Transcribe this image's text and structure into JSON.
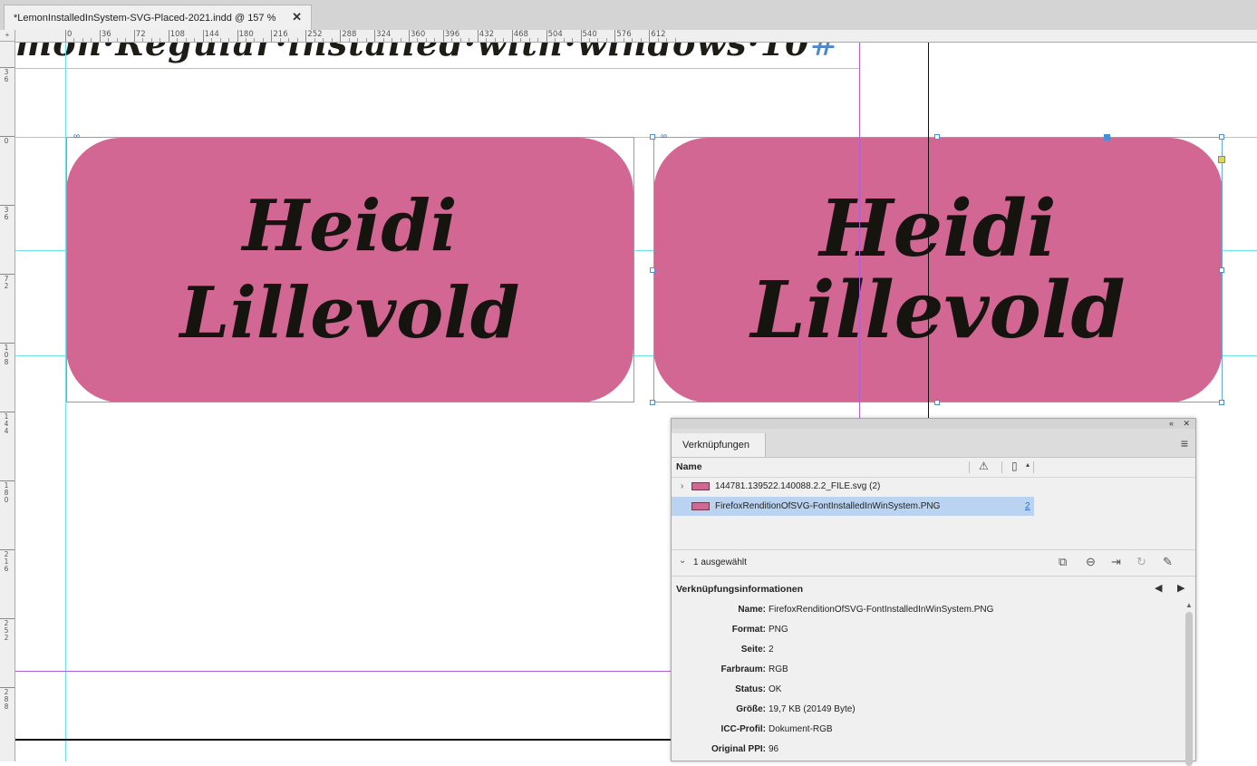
{
  "document": {
    "tab_title": "*LemonInstalledInSystem-SVG-Placed-2021.indd @ 157 %",
    "close_glyph": "✕"
  },
  "ruler": {
    "horizontal_ticks": [
      "0",
      "36",
      "72",
      "108",
      "144",
      "180",
      "216",
      "252",
      "288",
      "324",
      "360",
      "396",
      "432",
      "468",
      "504",
      "540",
      "576",
      "612"
    ],
    "vertical_ticks": [
      "3\n6",
      "0",
      "3\n6",
      "7\n2",
      "1\n0\n8",
      "1\n4\n4",
      "1\n8\n0",
      "2\n1\n6",
      "2\n5\n2",
      "2\n8\n8"
    ]
  },
  "canvas": {
    "headline_text": "mon·Regular·installed·with·windows·10",
    "headline_hash": "#",
    "pill_left": {
      "line1": "Heidi",
      "line2": "Lillevold"
    },
    "pill_right": {
      "line1": "Heidi",
      "line2": "Lillevold"
    },
    "pill_color": "#d36794",
    "link_badge": "∞"
  },
  "links_panel": {
    "collapse_glyph": "«",
    "close_glyph": "✕",
    "tab_label": "Verknüpfungen",
    "menu_glyph": "≡",
    "column_name": "Name",
    "warning_icon": "⚠",
    "page_icon": "▯",
    "sort_glyph": "▴",
    "rows": [
      {
        "expander": "›",
        "filename": "144781.139522.140088.2.2_FILE.svg (2)",
        "page": "",
        "selected": false
      },
      {
        "expander": "",
        "filename": "FirefoxRenditionOfSVG-FontInstalledInWinSystem.PNG",
        "page": "2",
        "selected": true
      }
    ],
    "status": {
      "chevron": "⌄",
      "selected_text": "1 ausgewählt",
      "tools": [
        "relink-cc-icon",
        "relink-icon",
        "goto-link-icon",
        "update-link-icon",
        "edit-original-icon"
      ]
    },
    "info_title": "Verknüpfungsinformationen",
    "info_nav_prev": "◀",
    "info_nav_next": "▶",
    "info": [
      {
        "key": "Name:",
        "value": "FirefoxRenditionOfSVG-FontInstalledInWinSystem.PNG"
      },
      {
        "key": "Format:",
        "value": "PNG"
      },
      {
        "key": "Seite:",
        "value": "2"
      },
      {
        "key": "Farbraum:",
        "value": "RGB"
      },
      {
        "key": "Status:",
        "value": "OK"
      },
      {
        "key": "Größe:",
        "value": "19,7 KB (20149 Byte)"
      },
      {
        "key": "ICC-Profil:",
        "value": "Dokument-RGB"
      },
      {
        "key": "Original PPI:",
        "value": "96"
      }
    ]
  }
}
